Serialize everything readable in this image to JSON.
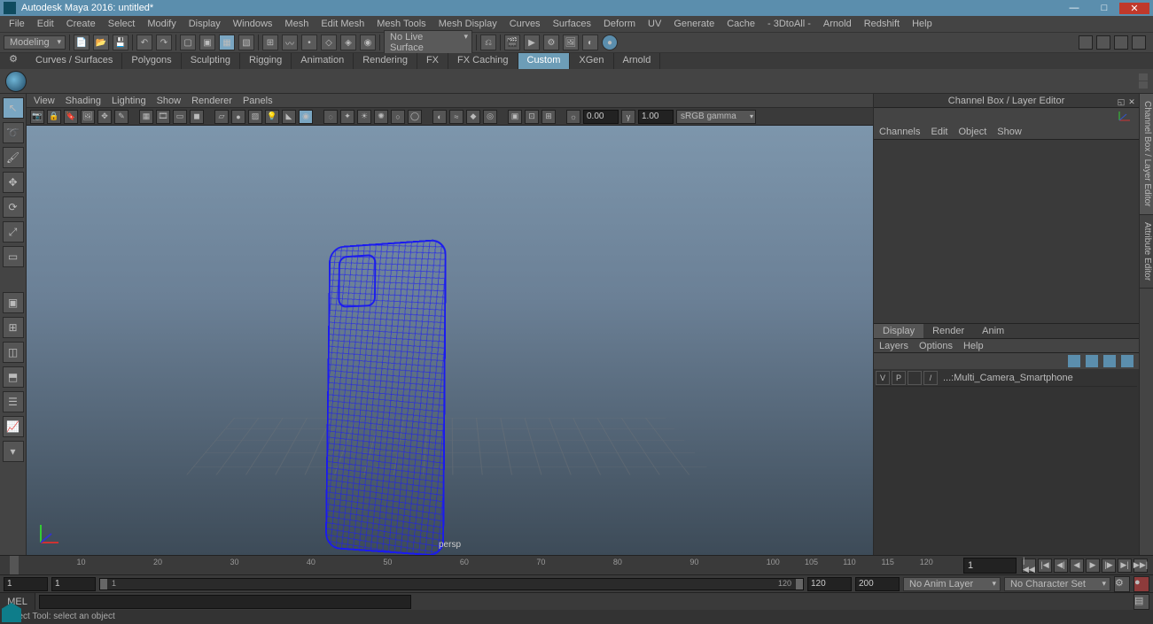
{
  "app": {
    "title": "Autodesk Maya 2016: untitled*"
  },
  "mainmenu": [
    "File",
    "Edit",
    "Create",
    "Select",
    "Modify",
    "Display",
    "Windows",
    "Mesh",
    "Edit Mesh",
    "Mesh Tools",
    "Mesh Display",
    "Curves",
    "Surfaces",
    "Deform",
    "UV",
    "Generate",
    "Cache",
    "- 3DtoAll -",
    "Arnold",
    "Redshift",
    "Help"
  ],
  "workspace_mode": "Modeling",
  "live_surface": "No Live Surface",
  "shelf_tabs": [
    "Curves / Surfaces",
    "Polygons",
    "Sculpting",
    "Rigging",
    "Animation",
    "Rendering",
    "FX",
    "FX Caching",
    "Custom",
    "XGen",
    "Arnold"
  ],
  "shelf_active": "Custom",
  "viewport_menu": [
    "View",
    "Shading",
    "Lighting",
    "Show",
    "Renderer",
    "Panels"
  ],
  "viewport_toolbar": {
    "num1": "0.00",
    "num2": "1.00",
    "colorspace": "sRGB gamma"
  },
  "viewport_label": "persp",
  "channelbox": {
    "title": "Channel Box / Layer Editor",
    "tabs": [
      "Channels",
      "Edit",
      "Object",
      "Show"
    ]
  },
  "display_tabs": [
    "Display",
    "Render",
    "Anim"
  ],
  "display_active": "Display",
  "display_sub": [
    "Layers",
    "Options",
    "Help"
  ],
  "layer": {
    "vis": "V",
    "play": "P",
    "tmpl": "/",
    "name": "...:Multi_Camera_Smartphone"
  },
  "side_tabs": [
    "Channel Box / Layer Editor",
    "Attribute Editor"
  ],
  "timeline": {
    "ticks": [
      1,
      10,
      20,
      30,
      40,
      50,
      60,
      70,
      80,
      90,
      100,
      105,
      110,
      115,
      120
    ],
    "current": "1"
  },
  "range": {
    "startOuter": "1",
    "startInner": "1",
    "innerL": "1",
    "innerR": "120",
    "endInner": "120",
    "endOuter": "200",
    "animLayer": "No Anim Layer",
    "charSet": "No Character Set"
  },
  "cmd_label": "MEL",
  "helpline": "Select Tool: select an object"
}
